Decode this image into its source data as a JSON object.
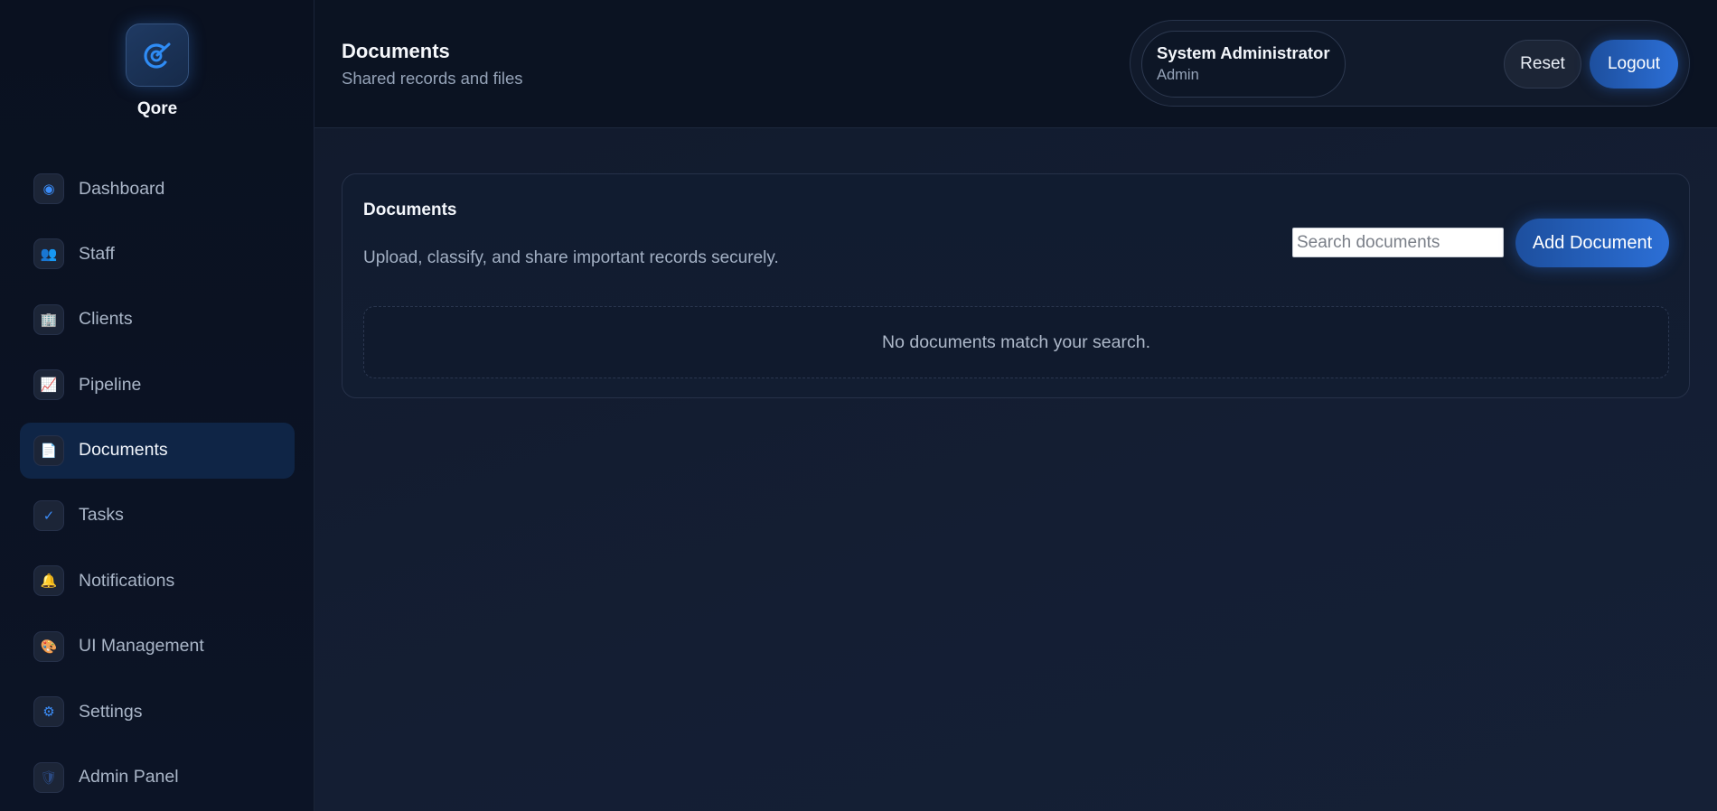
{
  "brand": {
    "name": "Qore",
    "logo_icon": "qore-logo-icon",
    "accent": "#2f8cf5"
  },
  "sidebar": {
    "items": [
      {
        "label": "Dashboard",
        "icon": "radio-dot-icon",
        "glyph": "◉",
        "color": "#3b8cf7",
        "active": false
      },
      {
        "label": "Staff",
        "icon": "people-icon",
        "glyph": "👥",
        "color": "#7d6ad8",
        "active": false
      },
      {
        "label": "Clients",
        "icon": "building-icon",
        "glyph": "🏢",
        "color": "#7fa6d9",
        "active": false
      },
      {
        "label": "Pipeline",
        "icon": "chart-increasing-icon",
        "glyph": "📈",
        "color": "#d9e2ee",
        "active": false
      },
      {
        "label": "Documents",
        "icon": "page-icon",
        "glyph": "📄",
        "color": "#d8d2ee",
        "active": true
      },
      {
        "label": "Tasks",
        "icon": "check-icon",
        "glyph": "✓",
        "color": "#3b8cf7",
        "active": false
      },
      {
        "label": "Notifications",
        "icon": "bell-icon",
        "glyph": "🔔",
        "color": "#f2b53a",
        "active": false
      },
      {
        "label": "UI Management",
        "icon": "palette-icon",
        "glyph": "🎨",
        "color": "#e99ab0",
        "active": false
      },
      {
        "label": "Settings",
        "icon": "gear-icon",
        "glyph": "⚙",
        "color": "#3b8cf7",
        "active": false
      },
      {
        "label": "Admin Panel",
        "icon": "shield-icon",
        "glyph": "🛡",
        "color": "#2b4a82",
        "active": false
      }
    ]
  },
  "header": {
    "title": "Documents",
    "subtitle": "Shared records and files",
    "user_name": "System Administrator",
    "user_role": "Admin",
    "reset_label": "Reset",
    "logout_label": "Logout"
  },
  "documents_card": {
    "title": "Documents",
    "description": "Upload, classify, and share important records securely.",
    "search_placeholder": "Search documents",
    "search_value": "",
    "add_label": "Add Document",
    "empty_message": "No documents match your search."
  }
}
